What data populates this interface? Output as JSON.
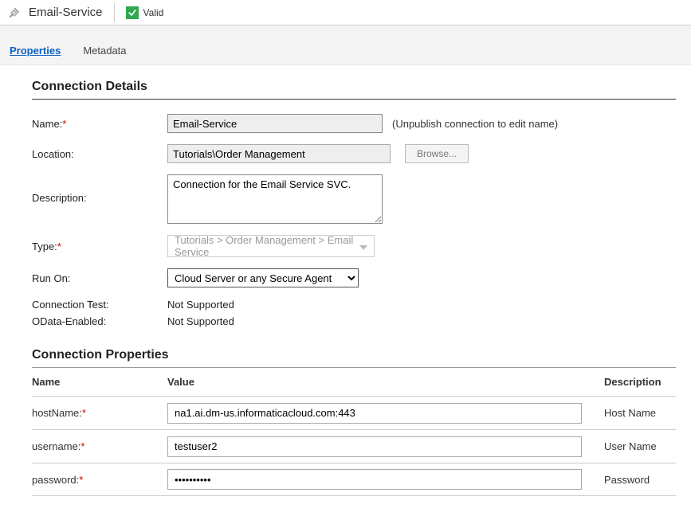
{
  "header": {
    "title": "Email-Service",
    "status_label": "Valid"
  },
  "tabs": {
    "properties": "Properties",
    "metadata": "Metadata"
  },
  "details": {
    "section_title": "Connection Details",
    "name_label": "Name:",
    "name_value": "Email-Service",
    "name_hint": "(Unpublish connection to edit name)",
    "location_label": "Location:",
    "location_value": "Tutorials\\Order Management",
    "browse_label": "Browse...",
    "description_label": "Description:",
    "description_value": "Connection for the Email Service SVC.",
    "type_label": "Type:",
    "type_value": "Tutorials > Order Management > Email Service",
    "runon_label": "Run On:",
    "runon_value": "Cloud Server or any Secure Agent",
    "conntest_label": "Connection Test:",
    "conntest_value": "Not Supported",
    "odata_label": "OData-Enabled:",
    "odata_value": "Not Supported"
  },
  "properties": {
    "section_title": "Connection Properties",
    "col_name": "Name",
    "col_value": "Value",
    "col_description": "Description",
    "rows": [
      {
        "name": "hostName:",
        "value": "na1.ai.dm-us.informaticacloud.com:443",
        "description": "Host Name"
      },
      {
        "name": "username:",
        "value": "testuser2",
        "description": "User Name"
      },
      {
        "name": "password:",
        "value": "••••••••••",
        "description": "Password"
      }
    ]
  }
}
